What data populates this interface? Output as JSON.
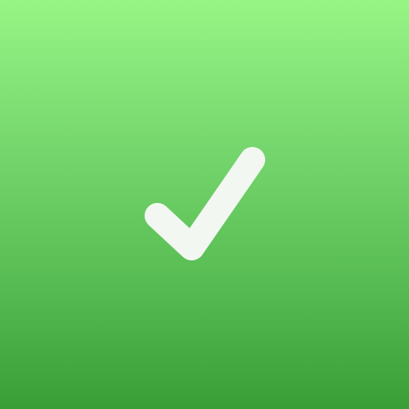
{
  "icon": {
    "name": "checkmark-icon",
    "background_top_color": "#97f585",
    "background_bottom_color": "#3a9e36",
    "glyph_color": "#f3f7f2"
  }
}
